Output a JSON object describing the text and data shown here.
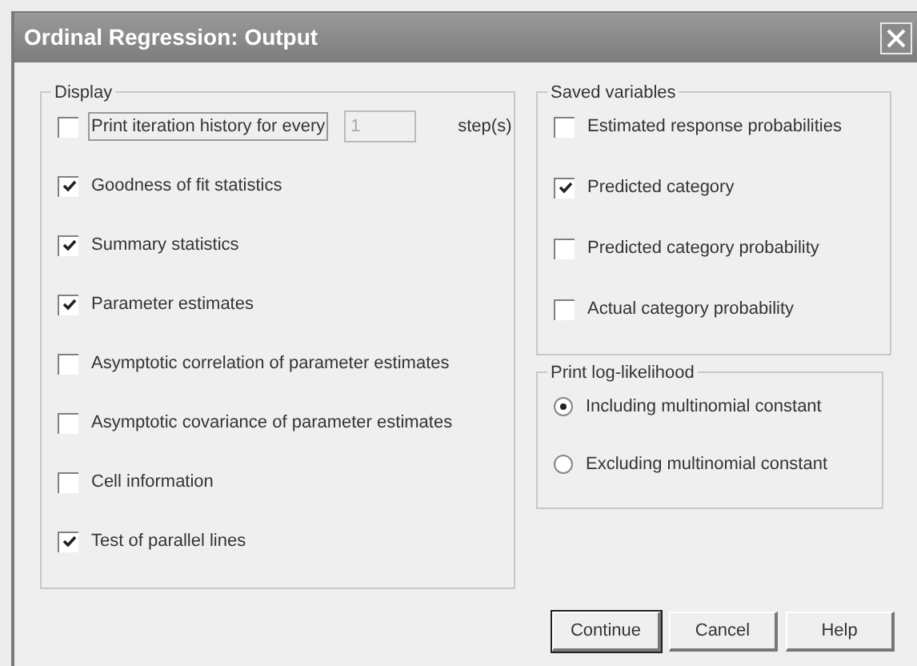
{
  "window": {
    "title": "Ordinal Regression: Output"
  },
  "display": {
    "title": "Display",
    "iteration": {
      "label": "Print iteration history for every",
      "checked": false,
      "value": "1",
      "unit": "step(s)"
    },
    "options": [
      {
        "label": "Goodness of fit statistics",
        "checked": true
      },
      {
        "label": "Summary statistics",
        "checked": true
      },
      {
        "label": "Parameter estimates",
        "checked": true
      },
      {
        "label": "Asymptotic correlation of parameter estimates",
        "checked": false
      },
      {
        "label": "Asymptotic covariance of parameter estimates",
        "checked": false
      },
      {
        "label": "Cell information",
        "checked": false
      },
      {
        "label": "Test of parallel lines",
        "checked": true
      }
    ]
  },
  "saved_variables": {
    "title": "Saved variables",
    "options": [
      {
        "label": "Estimated response probabilities",
        "checked": false
      },
      {
        "label": "Predicted category",
        "checked": true
      },
      {
        "label": "Predicted category probability",
        "checked": false
      },
      {
        "label": "Actual category probability",
        "checked": false
      }
    ]
  },
  "log_likelihood": {
    "title": "Print log-likelihood",
    "options": [
      {
        "label": "Including multinomial constant",
        "selected": true
      },
      {
        "label": "Excluding multinomial constant",
        "selected": false
      }
    ]
  },
  "buttons": [
    {
      "label": "Continue",
      "default": true
    },
    {
      "label": "Cancel",
      "default": false
    },
    {
      "label": "Help",
      "default": false
    }
  ]
}
